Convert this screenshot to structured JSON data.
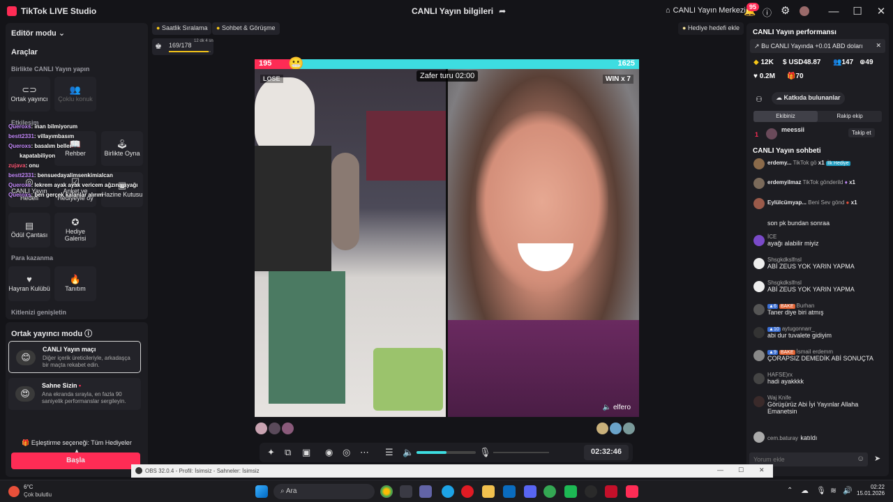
{
  "window": {
    "app_title": "TikTok LIVE Studio",
    "center_title": "CANLI Yayın bilgileri",
    "live_center": "CANLI Yayın Merkezi",
    "notif_count": "95"
  },
  "left": {
    "editor_mode": "Editör modu",
    "tools_heading": "Araçlar",
    "live_together": "Birlikte CANLI Yayın yapın",
    "tools_row1": [
      {
        "label": "Ortak yayıncı",
        "icon": "link-icon"
      },
      {
        "label": "Çoklu konuk",
        "icon": "people-icon"
      }
    ],
    "interaction_heading": "Etkileşim",
    "tools_row2": [
      {
        "label": "Rehber",
        "icon": "book-icon"
      },
      {
        "label": "Birlikte Oyna",
        "icon": "joystick-icon"
      }
    ],
    "tools_row3": [
      {
        "label": "CANLI Yayın Hedefi",
        "icon": "target-icon"
      },
      {
        "label": "Anket ve Hediyeyle oy",
        "icon": "poll-icon"
      },
      {
        "label": "Hazine Kutusu",
        "icon": "chest-icon"
      }
    ],
    "tools_row4": [
      {
        "label": "Ödül Çantası",
        "icon": "bag-icon"
      },
      {
        "label": "Hediye Galerisi",
        "icon": "gift-icon"
      }
    ],
    "earn_heading": "Para kazanma",
    "tools_row5": [
      {
        "label": "Hayran Kulübü",
        "icon": "heart-icon"
      },
      {
        "label": "Tanıtım",
        "icon": "flame-icon"
      }
    ],
    "expand_audience": "Kitlenizi genişletin",
    "overlay_chat": [
      {
        "n": "Queroxs",
        "m": ": inan bilmiyorum"
      },
      {
        "n": "bestt2331",
        "m": ": villayımbasım"
      },
      {
        "n": "Queroxs",
        "m": ": basalım beller"
      },
      {
        "n": "",
        "m": "kapatabiliyon"
      },
      {
        "n": "zujava",
        "m": ": onu"
      },
      {
        "n": "bestt2331",
        "m": ": bensuedayalimsenkimialcan"
      },
      {
        "n": "Queroxs",
        "m": ": lekrem ayak ayak vericem ağzına ayağı"
      },
      {
        "n": "Queroxs",
        "m": ": ben gerçek kalanlar alırım"
      }
    ],
    "cohost_mode": "Ortak yayıncı modu",
    "card1_title": "CANLI Yayın maçı",
    "card1_desc": "Diğer içerik üreticileriyle, arkadaşça bir maçta rekabet edin.",
    "card2_title": "Sahne Sizin",
    "card2_desc": "Ana ekranda sırayla, en fazla 90 saniyelik performanslar sergileyin.",
    "match_option": "Eşleştirme seçeneği: Tüm Hediyeler",
    "start": "Başla"
  },
  "top_chips": {
    "hourly": "Saatlik Sıralama",
    "chat": "Sohbet & Görüşme",
    "progress": "169/178",
    "progress_sub": "12 dk 4 sn",
    "progress_fraction": 0.95,
    "gift_goal": "Hediye hedefi ekle"
  },
  "stream": {
    "score_left": "195",
    "score_right": "1625",
    "timer": "Zafer turu 02:00",
    "lose": "LOSE",
    "win": "WIN x 7",
    "nick": "elfero"
  },
  "controls": {
    "elapsed": "02:32:46",
    "volume_fraction": 0.5
  },
  "right": {
    "perf_title": "CANLI Yayın performansı",
    "banner": "Bu CANLI Yayında +0.01 ABD doları",
    "stats1": {
      "diamonds": "12K",
      "usd": "USD48.87",
      "viewers": "147",
      "new": "49"
    },
    "stats2": {
      "likes": "0.2M",
      "gifts": "70"
    },
    "contributors": "Katkıda bulunanlar",
    "tab_mine": "Ekibiniz",
    "tab_rival": "Rakip ekip",
    "top_rank": "1",
    "top_user": "meessii",
    "follow": "Takip et",
    "chat_title": "CANLI Yayın sohbeti",
    "gifts": [
      {
        "name": "erdemy...",
        "text": "TikTok gö",
        "count": "x1",
        "tag": "İlk Hediye"
      },
      {
        "name": "erdemyilmaz",
        "text": "TikTok gönderild",
        "count": "x1",
        "tag": ""
      },
      {
        "name": "Eylülcümyap...",
        "text": "Beni Sev gönd",
        "count": "x1",
        "tag": ""
      }
    ],
    "messages": [
      {
        "user": "",
        "text": "son pk bundan sonraa"
      },
      {
        "user": "İCE",
        "text": "ayağı alabilir miyiz"
      },
      {
        "user": "Shsgkdkslfnsl",
        "text": "ABİ ZEUS YOK YARIN YAPMA"
      },
      {
        "user": "Shsgkdkslfnsl",
        "text": "ABİ ZEUS YOK YARIN YAPMA"
      },
      {
        "user": "Burhan",
        "text": "Taner diye biri atmış",
        "lvl": "6",
        "badge": "BAKE"
      },
      {
        "user": "aytugonnarr_",
        "text": "abi dur tuvalete gidiyim",
        "lvl": "10"
      },
      {
        "user": "İsmail erdemm",
        "text": "ÇORAPSIZ DEMEDİK ABİ SONUÇTA",
        "lvl": "9",
        "badge": "BAKE"
      },
      {
        "user": "HAFSE)rx",
        "text": "hadi ayakkkk"
      },
      {
        "user": "Waj Knife",
        "text": "Görüşürüz Abi İyi Yayınlar Allaha Emanetsin"
      },
      {
        "user": "cem.baturay",
        "text": "katıldı"
      }
    ],
    "comment_placeholder": "Yorum ekle"
  },
  "obs": {
    "title": "OBS 32.0.4 - Profil: İsimsiz - Sahneler: İsimsiz"
  },
  "taskbar": {
    "weather_temp": "6°C",
    "weather_desc": "Çok bulutlu",
    "search": "Ara",
    "time": "02:22",
    "date": "15.01.2026"
  },
  "colors": {
    "accent": "#fe2c55",
    "teal": "#3ddde1",
    "panel": "#1d1d22"
  }
}
